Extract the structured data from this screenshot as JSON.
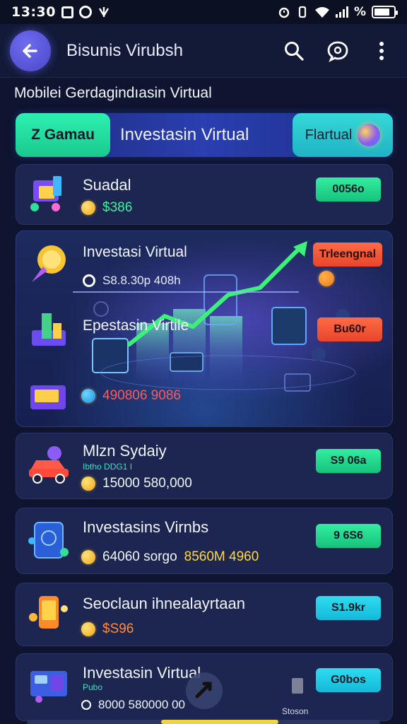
{
  "status_bar": {
    "time": "13:30",
    "battery_level": 0.8
  },
  "app_bar": {
    "title": "Bisunis Virubsh"
  },
  "subtitle": "Mobilei Gerdagindıasin Virtual",
  "tabs": {
    "left": "Z Gamau",
    "center": "Investasin Virtual",
    "right": "Flartual"
  },
  "cards": [
    {
      "title": "Suadal",
      "amount": "$386",
      "badge": "0056o"
    },
    {
      "title": "Mlzn Sydaiy",
      "small_label": "Ibtho DDG1 I",
      "amount": "15000 580,000",
      "badge": "S9 06a"
    },
    {
      "title": "Investasins Virnbs",
      "amount_a": "64060 sorgo",
      "amount_b": "8560M 4960",
      "badge": "9 6S6"
    },
    {
      "title": "Seoclaun ihnealayrtaan",
      "amount": "$S96",
      "badge": "S1.9kr"
    },
    {
      "title": "Investasin Virtual",
      "small_label": "Pubo",
      "amount": "8000 580000 00",
      "badge": "G0bos",
      "footer_label": "Stoson"
    }
  ],
  "feature": {
    "title": "Investasi Virtual",
    "meta_value": "S8.8.30p 408h",
    "second_title": "Epestasin Virtile",
    "amount": "490806 9086",
    "badge_top": "Trleengnal",
    "badge_mid": "Bu60r"
  },
  "colors": {
    "background": "#0f1530",
    "accent_green": "#1fd68f",
    "accent_cyan": "#1fc6e0",
    "accent_red": "#f05533",
    "accent_purple": "#5b58d8",
    "coin": "#f5b51e"
  }
}
